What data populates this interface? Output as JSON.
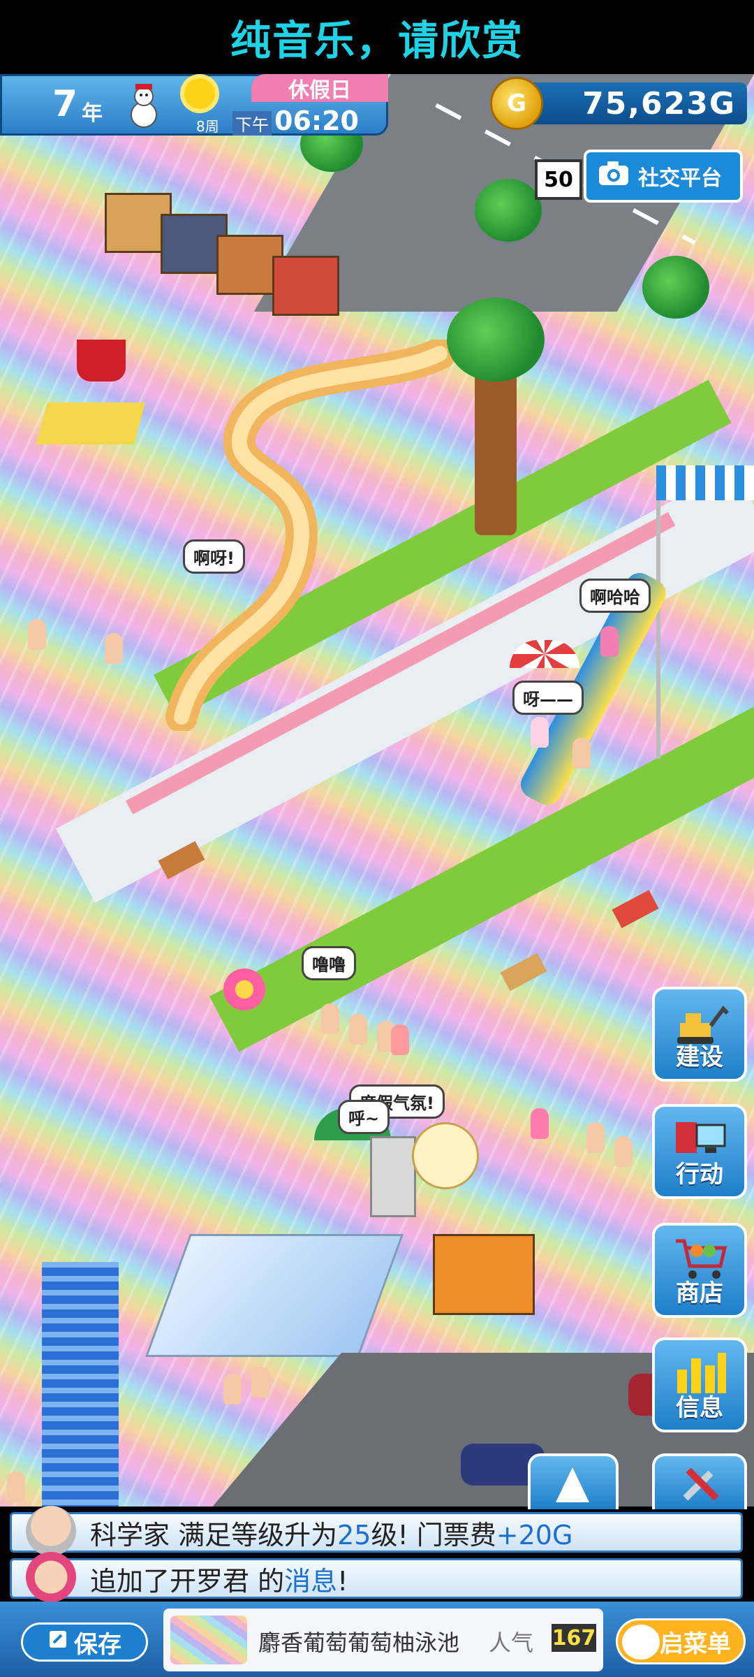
{
  "banner": {
    "title": "纯音乐，请欣赏"
  },
  "hud": {
    "year": "7",
    "year_unit": "年",
    "week": "8周",
    "ampm": "下午",
    "time": "06:20",
    "day_type": "休假日",
    "money": "75,623G",
    "coin_symbol": "G"
  },
  "social": {
    "count": "50",
    "label": "社交平台"
  },
  "bubbles": [
    "啊呀!",
    "啊哈哈",
    "呀——",
    "噜噜",
    "度假气氛!",
    "呼~"
  ],
  "side_buttons": [
    {
      "label": "建设",
      "icon": "excavator-icon"
    },
    {
      "label": "行动",
      "icon": "book-computer-icon"
    },
    {
      "label": "商店",
      "icon": "shopping-cart-icon"
    },
    {
      "label": "信息",
      "icon": "gold-bars-icon"
    }
  ],
  "messages": [
    {
      "prefix": "科学家 满足等级升为",
      "level": "25",
      "mid": "级!  门票费",
      "fee": "+20G"
    },
    {
      "prefix": "追加了开罗君 的",
      "highlight": "消息",
      "suffix": "!"
    }
  ],
  "bottom_bar": {
    "save_label": "保存",
    "facility_name": "麝香葡萄葡萄柚泳池",
    "popularity_label": "人气",
    "popularity_value": "167",
    "menu_label": "开启菜单"
  },
  "colors": {
    "accent": "#1c7fd0",
    "banner_text": "#1fd3e6",
    "menu": "#ffb31f",
    "holiday": "#f27fb1"
  }
}
